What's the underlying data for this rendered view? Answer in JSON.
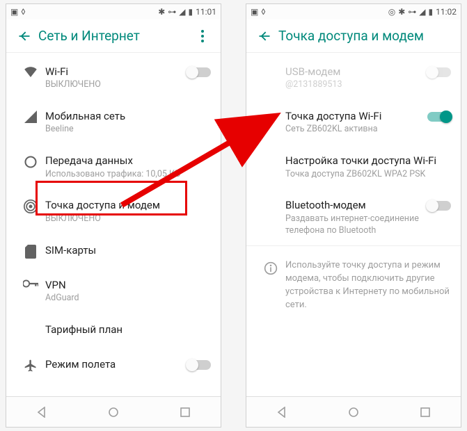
{
  "left": {
    "status_time": "11:01",
    "title": "Сеть и Интернет",
    "items": [
      {
        "title": "Wi-Fi",
        "sub": "ВЫКЛЮЧЕНО"
      },
      {
        "title": "Мобильная сеть",
        "sub": "Beeline"
      },
      {
        "title": "Передача данных",
        "sub": "Использовано трафика: 10,05 КБ"
      },
      {
        "title": "Точка доступа и модем",
        "sub": "ВЫКЛЮЧЕНО"
      },
      {
        "title": "SIM-карты",
        "sub": ""
      },
      {
        "title": "VPN",
        "sub": "AdGuard"
      },
      {
        "title": "Тарифный план",
        "sub": ""
      },
      {
        "title": "Режим полета",
        "sub": ""
      }
    ]
  },
  "right": {
    "status_time": "11:02",
    "title": "Точка доступа и модем",
    "items": [
      {
        "title": "USB-модем",
        "sub": "@2131889513"
      },
      {
        "title": "Точка доступа Wi-Fi",
        "sub": "Сеть ZB602KL активна"
      },
      {
        "title": "Настройка точки доступа Wi-Fi",
        "sub": "Точка доступа ZB602KL WPA2 PSK"
      },
      {
        "title": "Bluetooth-модем",
        "sub": "Раздавать интернет-соединение телефона по Bluetooth"
      }
    ],
    "info": "Используйте точку доступа и режим модема, чтобы подключить другие устройства к Интернету по мобильной сети."
  }
}
